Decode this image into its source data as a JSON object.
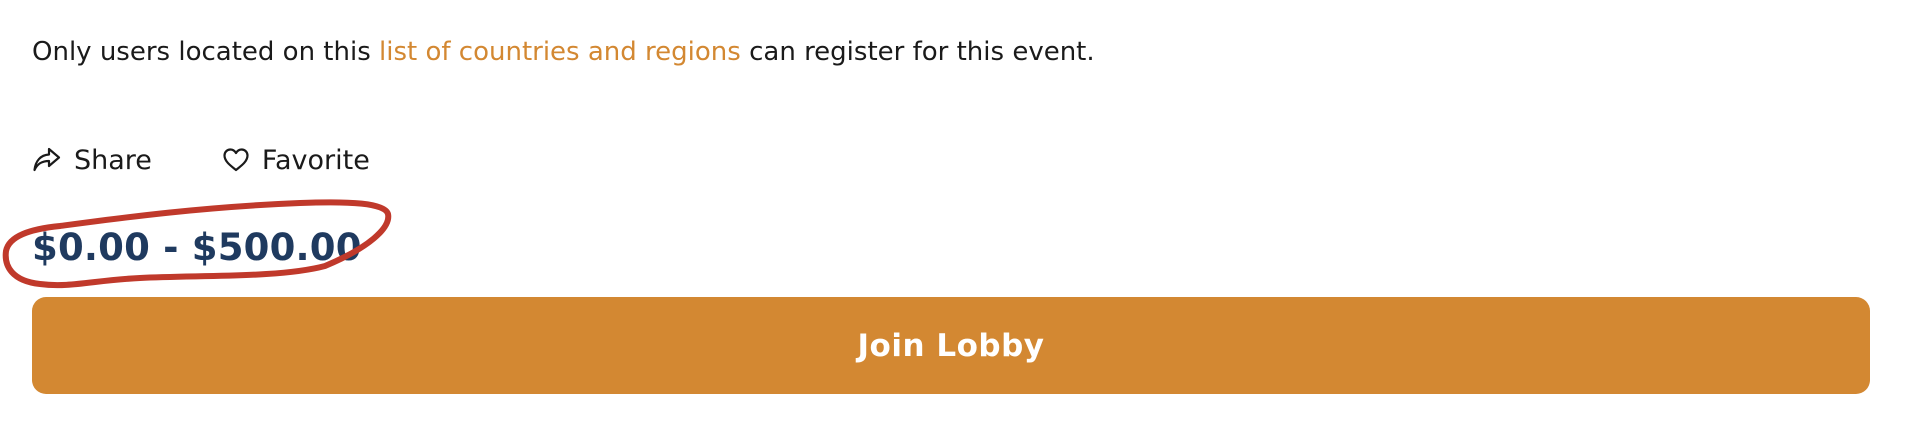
{
  "notice": {
    "before": "Only users located on this ",
    "link": "list of countries and regions",
    "after": " can register for this event."
  },
  "actions": {
    "share_label": "Share",
    "share_icon": "share-arrow-icon",
    "favorite_label": "Favorite",
    "favorite_icon": "heart-outline-icon"
  },
  "price": {
    "range": "$0.00 - $500.00"
  },
  "join": {
    "label": "Join Lobby"
  },
  "colors": {
    "accent": "#d38832",
    "price": "#1f3a5f",
    "annotation": "#c0392b",
    "button_text": "#ffffff"
  }
}
